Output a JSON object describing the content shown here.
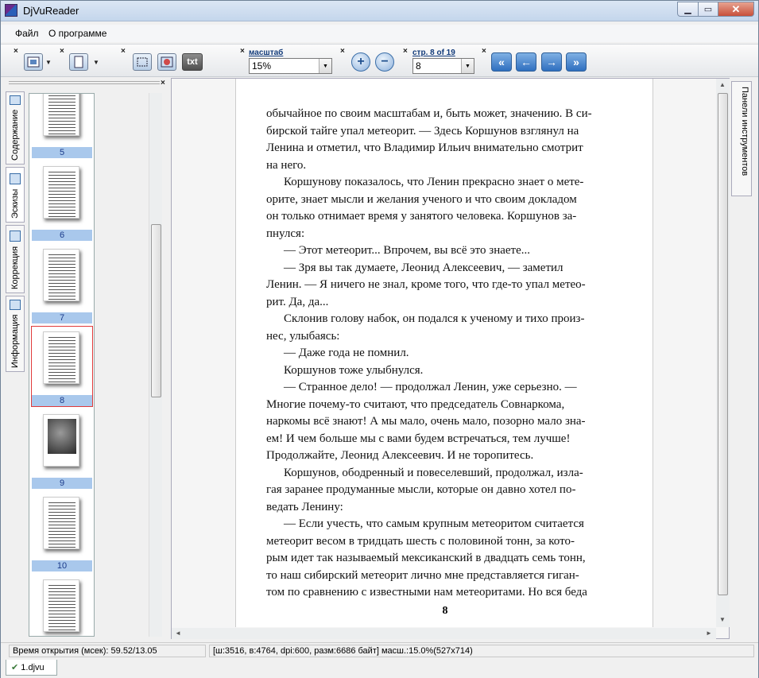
{
  "window": {
    "title": "DjVuReader"
  },
  "menu": {
    "file": "Файл",
    "about": "О программе"
  },
  "toolbar": {
    "zoom_label": "масштаб",
    "zoom_value": "15%",
    "page_label": "стр. 8 of 19",
    "page_value": "8",
    "txt_label": "txt"
  },
  "left_tabs": [
    "Содержание",
    "Эскизы",
    "Коррекция",
    "Информация"
  ],
  "thumbnails": [
    {
      "num": "5"
    },
    {
      "num": "6"
    },
    {
      "num": "7"
    },
    {
      "num": "8",
      "selected": true
    },
    {
      "num": "9",
      "photo": true
    },
    {
      "num": "10"
    },
    {
      "num": ""
    }
  ],
  "page": {
    "lines": [
      "обычайное по своим масштабам и, быть может, значению. В си-",
      "бирской тайге упал метеорит. — Здесь Коршунов взглянул на",
      "Ленина и отметил, что Владимир Ильич внимательно смотрит",
      "на него.",
      "Коршунову показалось, что Ленин прекрасно знает о мете-",
      "орите, знает мысли и желания ученого и что своим докладом",
      "он только отнимает время у занятого человека. Коршунов за-",
      "пнулся:",
      "— Этот метеорит... Впрочем, вы всё это знаете...",
      "— Зря вы так думаете, Леонид Алексеевич, — заметил",
      "Ленин. — Я ничего не знал, кроме того, что где-то упал метео-",
      "рит. Да, да...",
      "Склонив голову набок, он подался к ученому и тихо произ-",
      "нес, улыбаясь:",
      "— Даже года не помнил.",
      "Коршунов тоже улыбнулся.",
      "— Странное дело! — продолжал Ленин, уже серьезно. —",
      "Многие почему-то считают, что председатель Совнаркома,",
      "наркомы всё знают! А мы мало, очень мало, позорно мало зна-",
      "ем! И чем больше мы с вами будем встречаться, тем лучше!",
      "Продолжайте, Леонид Алексеевич. И не торопитесь.",
      "Коршунов, ободренный и повеселевший, продолжал, изла-",
      "гая заранее продуманные мысли, которые он давно хотел по-",
      "ведать Ленину:",
      "— Если учесть, что самым крупным метеоритом считается",
      "метеорит весом в тридцать шесть с половиной тонн, за кото-",
      "рым идет так называемый мексиканский в двадцать семь тонн,",
      "то наш сибирский метеорит лично мне представляется гиган-",
      "том по сравнению с известными нам метеоритами. Но вся беда"
    ],
    "indented": [
      0,
      0,
      0,
      0,
      1,
      0,
      0,
      0,
      1,
      1,
      0,
      0,
      1,
      0,
      1,
      1,
      1,
      0,
      0,
      0,
      0,
      1,
      0,
      0,
      1,
      0,
      0,
      0,
      0
    ],
    "number": "8"
  },
  "right_panel": {
    "label": "Панели инструментов"
  },
  "status": {
    "open_time": "Время открытия (мсек): 59.52/13.05",
    "info": "[ш:3516, в:4764, dpi:600, разм:6686 байт] масш.:15.0%(527x714)"
  },
  "tabs": {
    "doc": "1.djvu"
  }
}
